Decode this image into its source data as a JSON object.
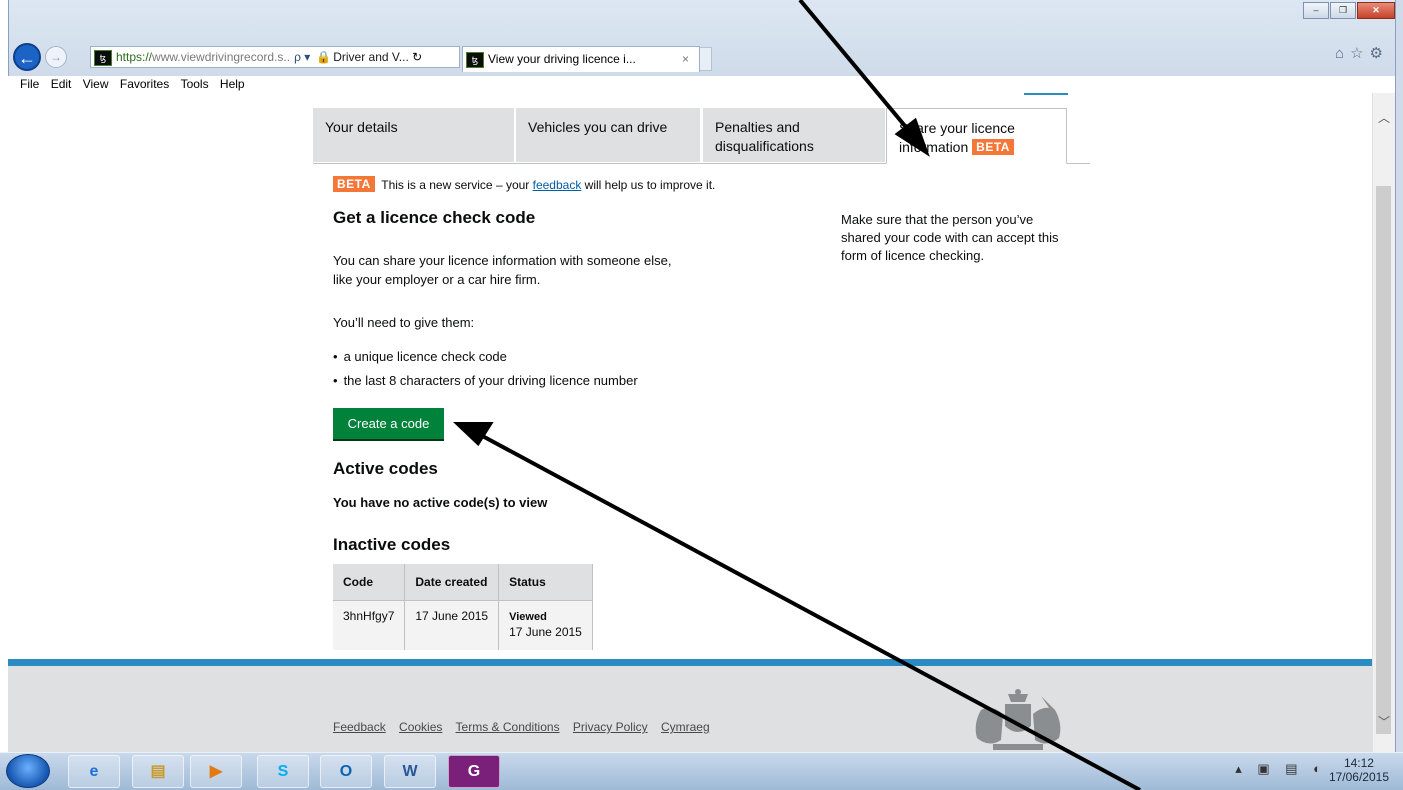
{
  "browser": {
    "address_https": "https://",
    "address_host": "www.viewdrivingrecord.s..",
    "address_tools": "ρ ▾",
    "site_name": "Driver and V...",
    "refresh_glyph": "↻",
    "tab_title": "View your driving licence i...",
    "tab_close": "×",
    "favicon_text": "ꜩ",
    "menu": [
      "File",
      "Edit",
      "View",
      "Favorites",
      "Tools",
      "Help"
    ],
    "window_buttons": [
      "–",
      "❐",
      "✕"
    ],
    "right_glyphs": "⌂☆⚙"
  },
  "page": {
    "tabs": [
      {
        "label": "Your details"
      },
      {
        "label": "Vehicles you can drive"
      },
      {
        "label": "Penalties and disqualifications"
      },
      {
        "label": "Share your licence information",
        "tag": "BETA"
      }
    ],
    "phase_banner": {
      "tag": "BETA",
      "text_before": "This is a new service – your ",
      "link": "feedback",
      "text_after": " will help us to improve it."
    },
    "heading": "Get a licence check code",
    "intro": "You can share your licence information with someone else, like your employer or a car hire firm.",
    "need_to_give": "You’ll need to give them:",
    "bullets": [
      "a unique licence check code",
      "the last 8 characters of your driving licence number"
    ],
    "create_button": "Create a code",
    "active_heading": "Active codes",
    "no_active": "You have no active code(s) to view",
    "inactive_heading": "Inactive codes",
    "table": {
      "headers": [
        "Code",
        "Date created",
        "Status"
      ],
      "rows": [
        {
          "code": "3hnHfgy7",
          "date": "17 June 2015",
          "status": "Viewed",
          "status_date": "17 June 2015"
        }
      ]
    },
    "aside": "Make sure that the person you’ve shared your code with can accept this form of licence checking.",
    "footer_links": [
      "Feedback",
      "Cookies",
      "Terms & Conditions",
      "Privacy Policy",
      "Cymraeg"
    ]
  },
  "taskbar": {
    "apps": [
      {
        "name": "internet-explorer-icon",
        "glyph": "e"
      },
      {
        "name": "file-explorer-icon",
        "glyph": "▤"
      },
      {
        "name": "media-player-icon",
        "glyph": "▶"
      },
      {
        "name": "skype-icon",
        "glyph": "S"
      },
      {
        "name": "outlook-icon",
        "glyph": "O"
      },
      {
        "name": "word-icon",
        "glyph": "W"
      },
      {
        "name": "pdf-icon",
        "glyph": "G"
      }
    ],
    "time": "14:12",
    "date": "17/06/2015"
  },
  "colors": {
    "accent_blue": "#2b8cc4",
    "button_green": "#00823b",
    "beta_orange": "#f47738",
    "link_blue": "#005ea5"
  }
}
